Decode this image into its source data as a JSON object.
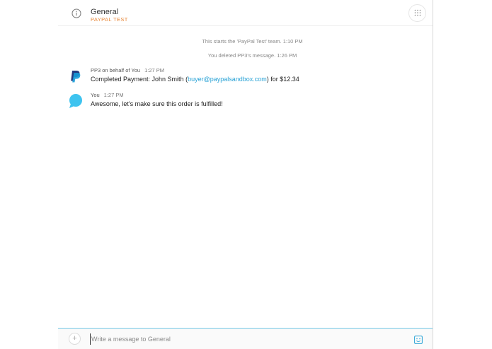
{
  "header": {
    "channel_name": "General",
    "team_name": "PAYPAL TEST",
    "info_icon": "info-icon",
    "apps_icon": "grid-icon"
  },
  "system_messages": [
    "This starts the 'PayPal Test' team. 1:10 PM",
    "You deleted PP3's message. 1:26 PM"
  ],
  "messages": [
    {
      "author": "PP3 on behalf of You",
      "time": "1:27 PM",
      "avatar_icon": "paypal-logo-icon",
      "text_before": "Completed Payment: John Smith (",
      "link": "buyer@paypalsandbox.com",
      "text_after": ") for $12.34"
    },
    {
      "author": "You",
      "time": "1:27 PM",
      "avatar_icon": "chat-bubble-icon",
      "text": "Awesome, let's make sure this order is fulfilled!"
    }
  ],
  "composer": {
    "placeholder": "Write a message to General",
    "value": "",
    "add_label": "+",
    "emoji_icon": "emoji-icon"
  },
  "colors": {
    "accent": "#2aa3d6",
    "team_label": "#e8883a",
    "composer_border": "#6fc5e4",
    "paypal_dark": "#253b80",
    "paypal_light": "#179bd7"
  }
}
